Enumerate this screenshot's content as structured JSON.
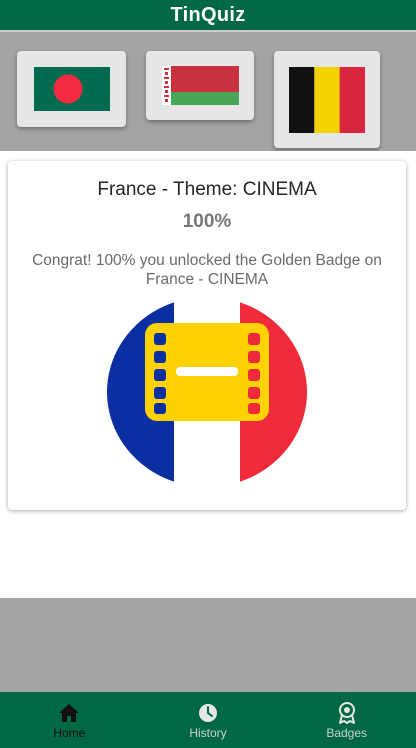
{
  "app": {
    "title": "TinQuiz"
  },
  "flags": [
    {
      "country": "Bangladesh",
      "icon": "bangladesh-flag"
    },
    {
      "country": "Belarus",
      "icon": "belarus-flag"
    },
    {
      "country": "Belgium",
      "icon": "belgium-flag"
    }
  ],
  "result": {
    "heading": "France - Theme: CINEMA",
    "score": "100%",
    "message": "Congrat! 100% you unlocked the Golden Badge on France - CINEMA",
    "badge_icon": "cinema-film-badge"
  },
  "nav": {
    "items": [
      {
        "label": "Home",
        "icon": "home-icon",
        "active": true
      },
      {
        "label": "History",
        "icon": "clock-icon",
        "active": false
      },
      {
        "label": "Badges",
        "icon": "badge-icon",
        "active": false
      }
    ]
  },
  "colors": {
    "primary": "#006847",
    "france_blue": "#0a2fa3",
    "france_red": "#ef2a3a",
    "gold": "#ffd200"
  }
}
